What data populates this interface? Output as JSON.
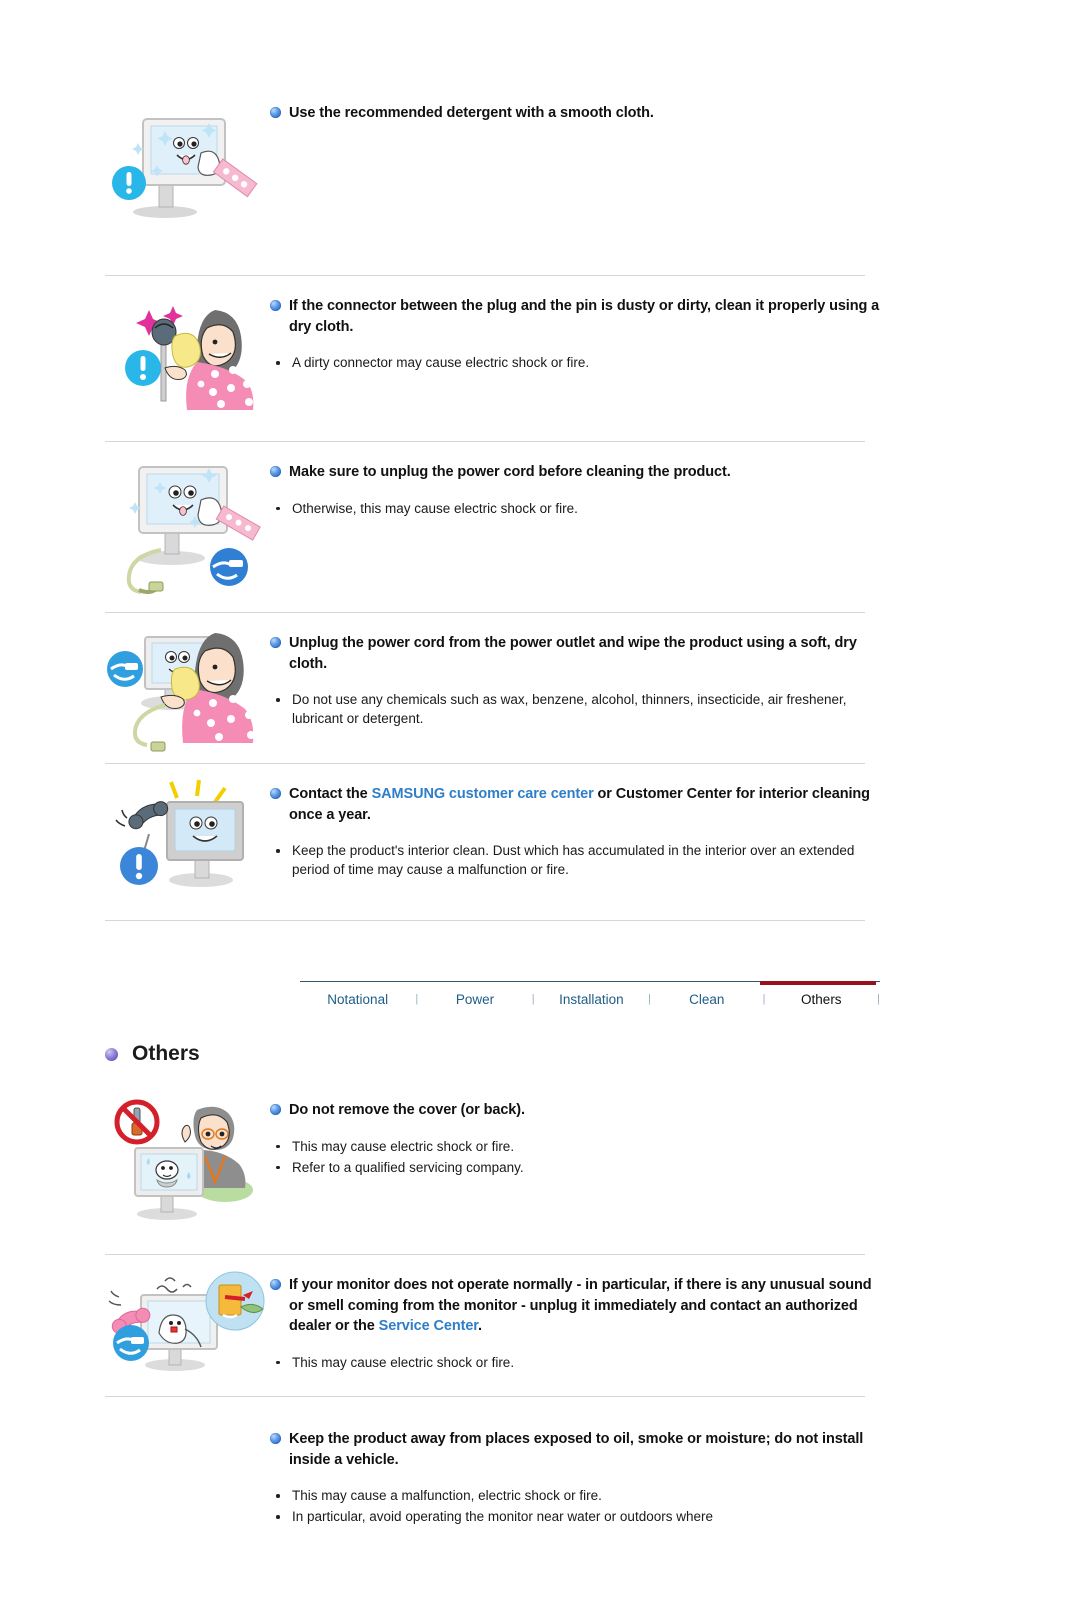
{
  "document": {
    "section_title": "Others",
    "section_bullet_icon": "purple-sphere-bullet"
  },
  "tabbar": {
    "items": [
      {
        "label": "Notational",
        "active": false
      },
      {
        "label": "Power",
        "active": false
      },
      {
        "label": "Installation",
        "active": false
      },
      {
        "label": "Clean",
        "active": false
      },
      {
        "label": "Others",
        "active": true
      }
    ],
    "separator": "|",
    "active_accent_color": "#99111e",
    "link_color": "#1f5d86"
  },
  "clean_items": [
    {
      "id": "detergent",
      "figure": "monitor-wiped-with-cloth",
      "heading_pre": "Use the recommended detergent with a smooth cloth.",
      "heading_link": "",
      "heading_post": "",
      "bullets": []
    },
    {
      "id": "connector",
      "figure": "woman-cleaning-plug",
      "heading_pre": "If the connector between the plug and the pin is dusty or dirty, clean it properly using a dry cloth.",
      "heading_link": "",
      "heading_post": "",
      "bullets": [
        "A dirty connector may cause electric shock or fire."
      ]
    },
    {
      "id": "unplug-before-clean",
      "figure": "monitor-with-unplugged-cord",
      "heading_pre": "Make sure to unplug the power cord before cleaning the product.",
      "heading_link": "",
      "heading_post": "",
      "bullets": [
        "Otherwise, this may cause electric shock or fire."
      ]
    },
    {
      "id": "soft-dry-cloth",
      "figure": "woman-wiping-monitor",
      "heading_pre": "Unplug the power cord from the power outlet and wipe the product using a soft, dry cloth.",
      "heading_link": "",
      "heading_post": "",
      "bullets": [
        "Do not use any chemicals such as wax, benzene, alcohol, thinners, insecticide, air freshener, lubricant or detergent."
      ]
    },
    {
      "id": "service-center-yearly",
      "figure": "monitor-with-telephone",
      "heading_pre": "Contact the ",
      "heading_link": "SAMSUNG customer care center",
      "heading_post": " or Customer Center for interior cleaning once a year.",
      "bullets": [
        "Keep the product's interior clean. Dust which has accumulated in the interior over an extended period of time may cause a malfunction or fire."
      ]
    }
  ],
  "others_items": [
    {
      "id": "do-not-remove-cover",
      "figure": "no-screwdriver-technician",
      "heading_pre": "Do not remove the cover (or back).",
      "heading_link": "",
      "heading_post": "",
      "bullets": [
        "This may cause electric shock or fire.",
        "Refer to a qualified servicing company."
      ]
    },
    {
      "id": "abnormal-operation",
      "figure": "smoking-monitor-with-phone",
      "heading_pre": "If your monitor does not operate normally - in particular, if there is any unusual sound or smell coming from the monitor - unplug it immediately and contact an authorized dealer or the ",
      "heading_link": "Service Center",
      "heading_post": ".",
      "bullets": [
        "This may cause electric shock or fire."
      ]
    },
    {
      "id": "oil-smoke-moisture",
      "figure": "",
      "heading_pre": "Keep the product away from places exposed to oil, smoke or moisture; do not install inside a vehicle.",
      "heading_link": "",
      "heading_post": "",
      "bullets": [
        "This may cause a malfunction, electric shock or fire.",
        "In particular, avoid operating the monitor near water or outdoors where"
      ]
    }
  ]
}
